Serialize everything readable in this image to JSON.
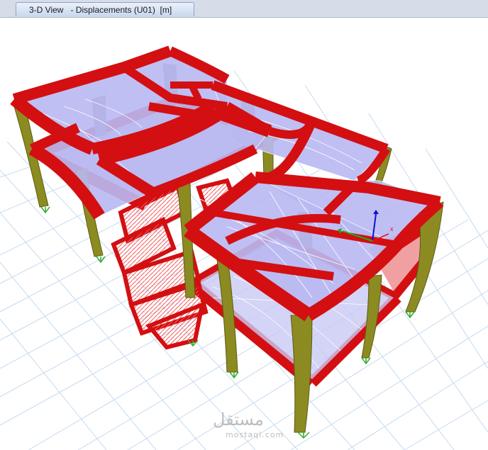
{
  "window": {
    "tab_title": "3-D View   - Displacements (U01)  [m]"
  },
  "model": {
    "frame_color": "#d30f12",
    "slab_color": "#b9b9f2",
    "column_color": "#8b8b22",
    "grid_color": "#c6daf0",
    "support_color": "#2fae2f"
  },
  "axes": {
    "x_label": "x",
    "icons": [
      "x-axis-arrow",
      "y-axis-arrow",
      "z-axis-arrow"
    ]
  },
  "watermark": {
    "logo_text": "مستقل",
    "url_text": "mostaql.com"
  }
}
